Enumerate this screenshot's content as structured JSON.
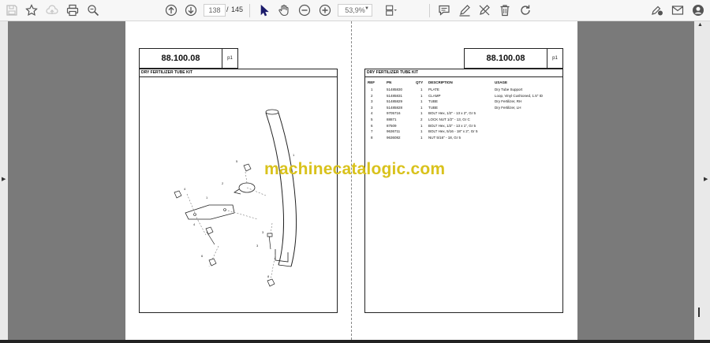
{
  "toolbar": {
    "current_page": "138",
    "page_separator": "/",
    "total_pages": "145",
    "zoom": "53,9%"
  },
  "left_page": {
    "catalog_number": "88.100.08",
    "page_marker": "p1",
    "section_title": "DRY FERTILIZER TUBE KIT",
    "callouts": [
      "1",
      "2",
      "3",
      "4",
      "5",
      "6",
      "7",
      "8"
    ]
  },
  "right_page": {
    "catalog_number": "88.100.08",
    "page_marker": "p1",
    "section_title": "DRY FERTILIZER TUBE KIT",
    "columns": [
      "REF",
      "PN",
      "QTY",
      "DESCRIPTION",
      "USAGE"
    ],
    "rows": [
      {
        "ref": "1",
        "pn": "51485830",
        "qty": "1",
        "description": "PLATE",
        "usage": "Dry Tube Support"
      },
      {
        "ref": "2",
        "pn": "51485831",
        "qty": "1",
        "description": "CLAMP",
        "usage": "Loop, Vinyl Cushioned, 1.5\" ID"
      },
      {
        "ref": "3",
        "pn": "51485829",
        "qty": "1",
        "description": "TUBE",
        "usage": "Dry Fertilizer, RH"
      },
      {
        "ref": "3",
        "pn": "51485828",
        "qty": "1",
        "description": "TUBE",
        "usage": "Dry Fertilizer, LH"
      },
      {
        "ref": "4",
        "pn": "9705716",
        "qty": "1",
        "description": "BOLT Hex, 1/2\" - 13 x 2\", Gr 5",
        "usage": ""
      },
      {
        "ref": "5",
        "pn": "88871",
        "qty": "2",
        "description": "LOCK NUT 1/2\" - 13, Gr C",
        "usage": ""
      },
      {
        "ref": "6",
        "pn": "87509",
        "qty": "1",
        "description": "BOLT Hex, 1/2\" - 13 x 1\", Gr 5",
        "usage": ""
      },
      {
        "ref": "7",
        "pn": "9636711",
        "qty": "1",
        "description": "BOLT Hex, 5/16 - 18\" x 2\", Gr 5",
        "usage": ""
      },
      {
        "ref": "8",
        "pn": "9636082",
        "qty": "1",
        "description": "NUT 5/16\" - 18, Gr 5",
        "usage": ""
      }
    ]
  },
  "watermark": "machinecatalogic.com",
  "colors": {
    "watermark": "#d9c21c",
    "viewer_background": "#7a7a7a",
    "toolbar": "#f7f7f7"
  }
}
